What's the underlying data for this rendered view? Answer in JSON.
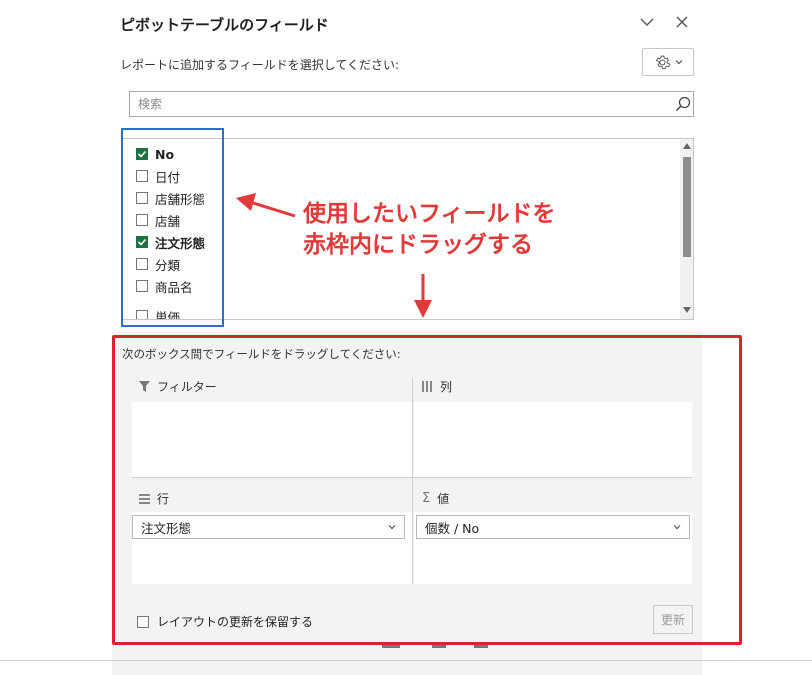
{
  "pane": {
    "title": "ピボットテーブルのフィールド",
    "subtitle": "レポートに追加するフィールドを選択してください:",
    "search_placeholder": "検索"
  },
  "fields": [
    {
      "label": "No",
      "checked": true
    },
    {
      "label": "日付",
      "checked": false
    },
    {
      "label": "店舗形態",
      "checked": false
    },
    {
      "label": "店舗",
      "checked": false
    },
    {
      "label": "注文形態",
      "checked": true
    },
    {
      "label": "分類",
      "checked": false
    },
    {
      "label": "商品名",
      "checked": false
    },
    {
      "label": "単価",
      "checked": false
    }
  ],
  "areas": {
    "instruction": "次のボックス間でフィールドをドラッグしてください:",
    "filter_label": "フィルター",
    "columns_label": "列",
    "rows_label": "行",
    "values_label": "値",
    "rows_item": "注文形態",
    "values_item": "個数 / No"
  },
  "footer": {
    "defer_label": "レイアウトの更新を保留する",
    "update_label": "更新"
  },
  "annotation": {
    "line1": "使用したいフィールドを",
    "line2": "赤枠内にドラッグする",
    "color": "#e23a3a"
  },
  "colors": {
    "checkbox_checked": "#1e7145",
    "highlight_blue": "#2f6fc7",
    "highlight_red": "#d9232d"
  }
}
